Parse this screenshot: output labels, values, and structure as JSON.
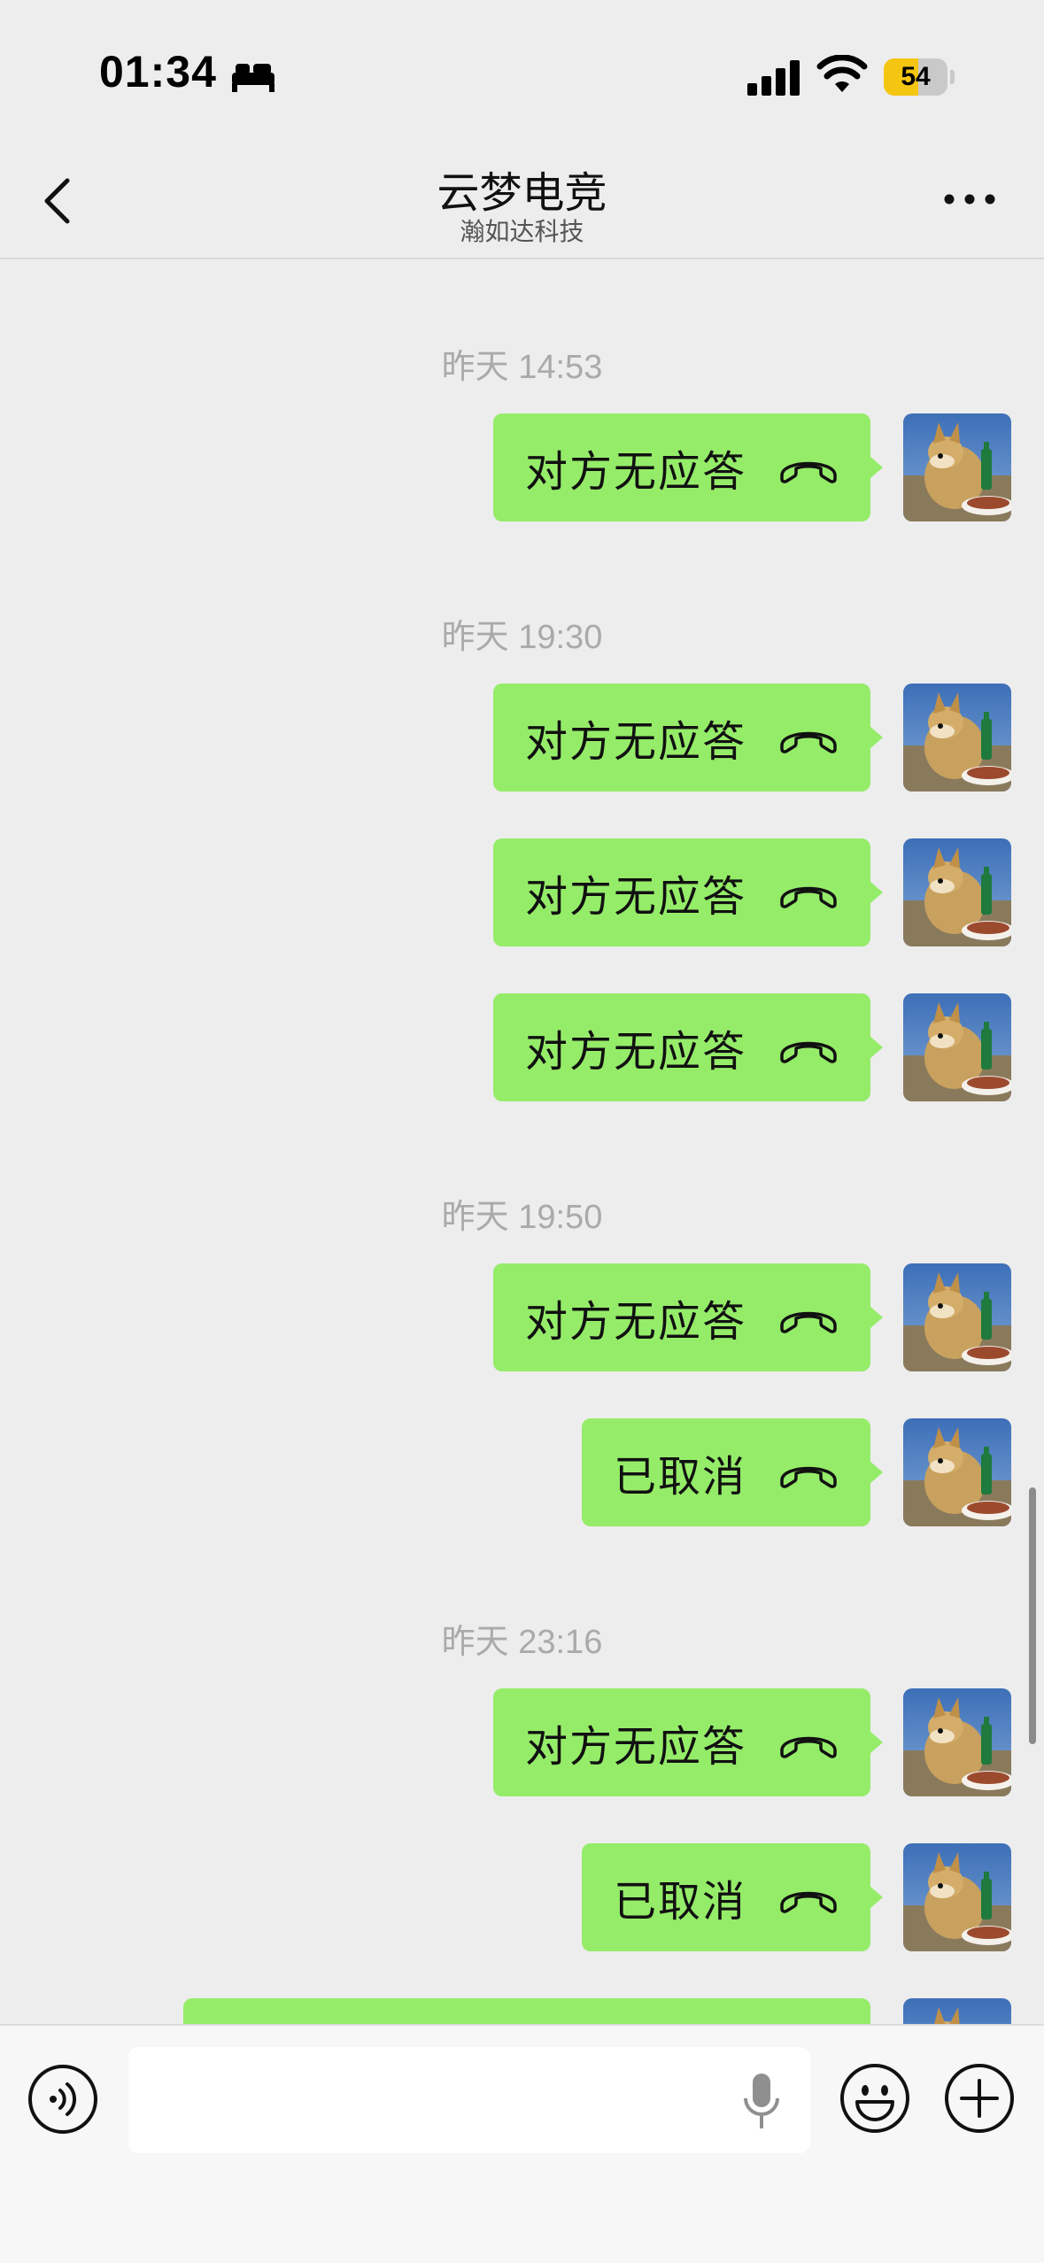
{
  "status_bar": {
    "time": "01:34",
    "sleep_icon": "bed-icon",
    "signal_icon": "cellular-signal-icon",
    "wifi_icon": "wifi-icon",
    "battery_level": "54",
    "battery_fraction": 0.54,
    "battery_color": "#f5c611"
  },
  "nav": {
    "title": "云梦电竞",
    "subtitle": "瀚如达科技",
    "back_icon": "chevron-left-icon",
    "more_icon": "more-dots-icon"
  },
  "colors": {
    "bubble": "#95ec69",
    "background": "#ededed",
    "timestamp": "#aaaaaa"
  },
  "messages": [
    {
      "type": "timestamp",
      "text": "昨天 14:53"
    },
    {
      "type": "call",
      "text": "对方无应答",
      "icon": "phone-hangup-icon"
    },
    {
      "type": "timestamp",
      "text": "昨天 19:30"
    },
    {
      "type": "call",
      "text": "对方无应答",
      "icon": "phone-hangup-icon"
    },
    {
      "type": "call",
      "text": "对方无应答",
      "icon": "phone-hangup-icon"
    },
    {
      "type": "call",
      "text": "对方无应答",
      "icon": "phone-hangup-icon"
    },
    {
      "type": "timestamp",
      "text": "昨天 19:50"
    },
    {
      "type": "call",
      "text": "对方无应答",
      "icon": "phone-hangup-icon"
    },
    {
      "type": "call",
      "text": "已取消",
      "icon": "phone-hangup-icon"
    },
    {
      "type": "timestamp",
      "text": "昨天 23:16"
    },
    {
      "type": "call",
      "text": "对方无应答",
      "icon": "phone-hangup-icon"
    },
    {
      "type": "call",
      "text": "已取消",
      "icon": "phone-hangup-icon"
    }
  ],
  "input_bar": {
    "voice_icon": "voice-mode-icon",
    "mic_icon": "microphone-icon",
    "emoji_icon": "emoji-smile-icon",
    "plus_icon": "plus-circle-icon",
    "input_value": ""
  }
}
